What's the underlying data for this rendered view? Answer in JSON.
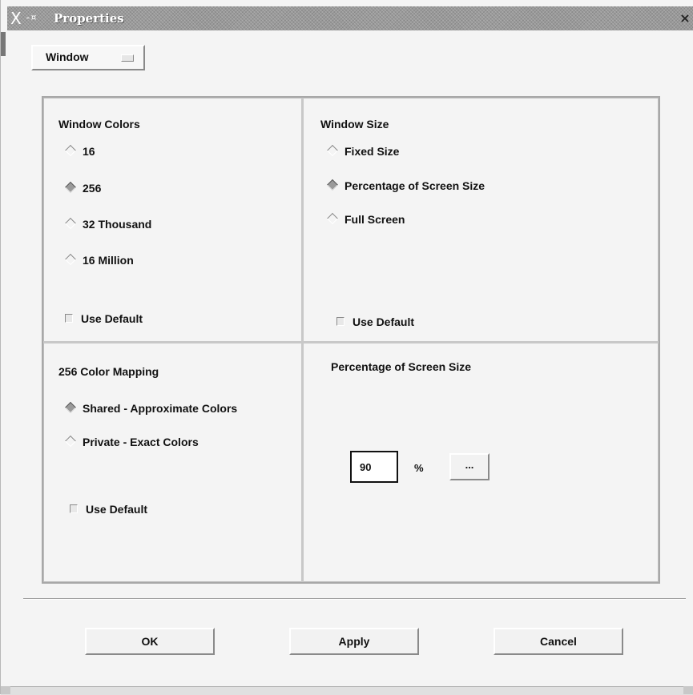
{
  "window": {
    "title": "Properties",
    "close_glyph": "×",
    "title_glyph": "X",
    "menu_glyph": "-¤"
  },
  "category_menu": {
    "selected": "Window",
    "icon": "option-menu-indicator-icon"
  },
  "colors_frame": {
    "title": "Window Colors",
    "options": [
      {
        "label": "16",
        "selected": false
      },
      {
        "label": "256",
        "selected": true
      },
      {
        "label": "32 Thousand",
        "selected": false
      },
      {
        "label": "16 Million",
        "selected": false
      }
    ],
    "use_default_label": "Use Default",
    "use_default_checked": false
  },
  "size_frame": {
    "title": "Window Size",
    "options": [
      {
        "label": "Fixed Size",
        "selected": false
      },
      {
        "label": "Percentage of Screen Size",
        "selected": true
      },
      {
        "label": "Full Screen",
        "selected": false
      }
    ],
    "use_default_label": "Use Default",
    "use_default_checked": false
  },
  "mapping_frame": {
    "title": "256 Color Mapping",
    "options": [
      {
        "label": "Shared - Approximate Colors",
        "selected": true
      },
      {
        "label": "Private - Exact Colors",
        "selected": false
      }
    ],
    "use_default_label": "Use Default",
    "use_default_checked": false
  },
  "percent_frame": {
    "title": "Percentage of Screen Size",
    "value": "90",
    "unit": "%",
    "browse_label": "..."
  },
  "buttons": {
    "ok": "OK",
    "apply": "Apply",
    "cancel": "Cancel"
  },
  "colors": {
    "titlebar": "#9a9a9a",
    "background": "#f4f4f4"
  }
}
